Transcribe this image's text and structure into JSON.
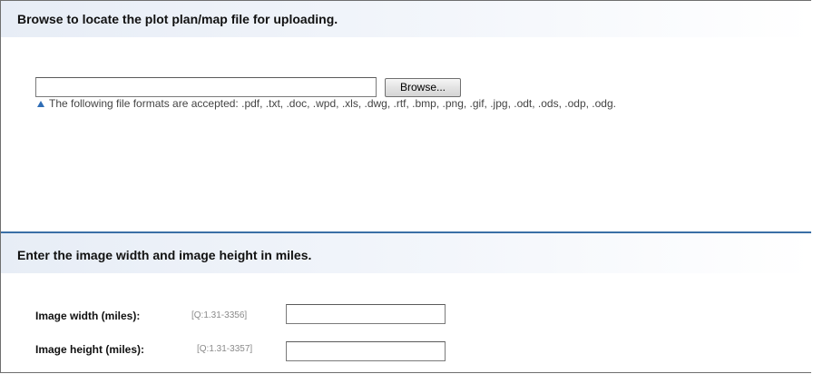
{
  "upload_section": {
    "title": "Browse to locate the plot plan/map file for uploading.",
    "file_value": "",
    "browse_label": "Browse...",
    "hint_icon": "triangle-up-icon",
    "hint_text": "The following file formats are accepted: .pdf, .txt, .doc, .wpd, .xls, .dwg, .rtf, .bmp, .png, .gif, .jpg, .odt, .ods, .odp, .odg."
  },
  "dimensions_section": {
    "title": "Enter the image width and image height in miles.",
    "fields": [
      {
        "label": "Image width (miles):",
        "code": "[Q:1.31-3356]",
        "value": ""
      },
      {
        "label": "Image height (miles):",
        "code": "[Q:1.31-3357]",
        "value": ""
      }
    ]
  },
  "colors": {
    "header_gradient_start": "#e7edf6",
    "section_divider": "#3a6fa6",
    "hint_triangle": "#2f6db5",
    "question_code": "#8a8a8a"
  }
}
